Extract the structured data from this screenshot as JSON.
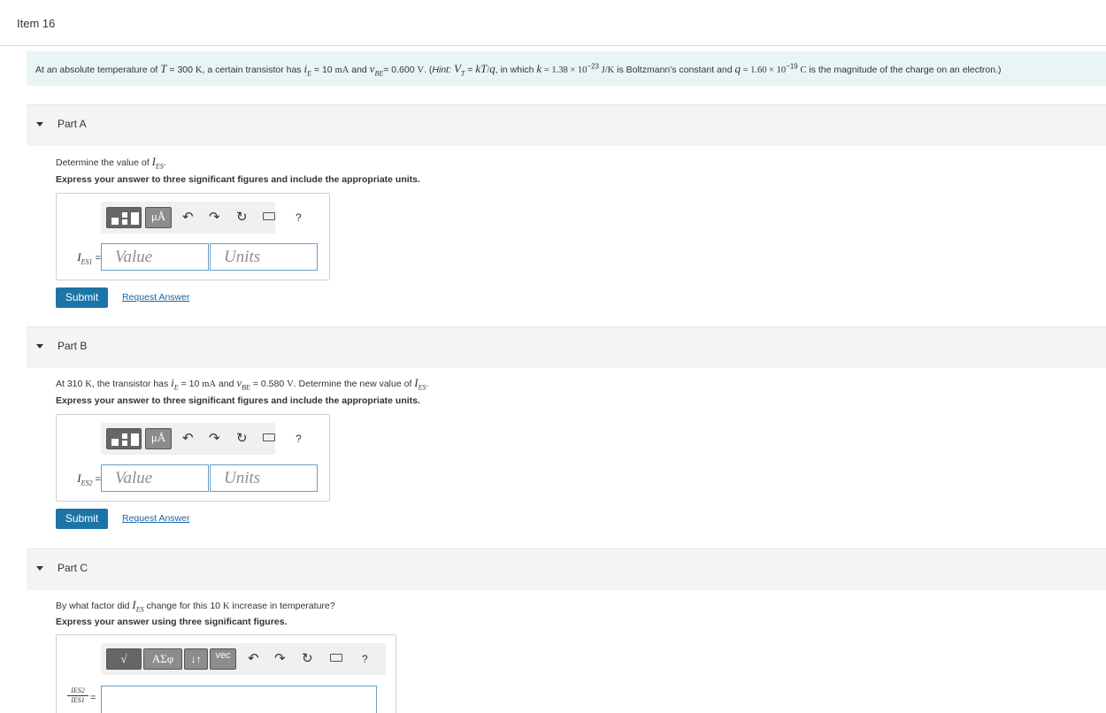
{
  "item_title": "Item 16",
  "problem": {
    "t1": "At an absolute temperature of ",
    "T": "T",
    "t2": " = 300 ",
    "K": "K",
    "t3": ", a certain transistor has ",
    "iE": "i",
    "iE_sub": "E",
    "t4": " = 10 ",
    "mA": "mA",
    "t5": " and ",
    "vBE": "v",
    "vBE_sub": "BE",
    "t6": "= 0.600 ",
    "V": "V",
    "t7": ". (",
    "hint": "Hint:",
    "t8": " ",
    "VT": "V",
    "VT_sub": "T",
    "t9": " = ",
    "kT": "kT",
    "slash": "/",
    "q": "q",
    "t10": ", in which ",
    "k": "k",
    "t11": " = 1.38 × 10",
    "exp1": "−23",
    "t12": " J/K",
    "t13": " is Boltzmann's constant and ",
    "q2": "q",
    "t14": " = 1.60 × 10",
    "exp2": "−19",
    "t15": " C",
    "t16": " is the magnitude of the charge on an electron.)"
  },
  "partA": {
    "label": "Part A",
    "prompt_pre": "Determine the value of ",
    "I": "I",
    "I_sub": "ES",
    "prompt_post": ".",
    "instruction": "Express your answer to three significant figures and include the appropriate units.",
    "mu": "μÅ",
    "help": "?",
    "var": "I",
    "var_sub": "ES1",
    "eq": "=",
    "value_placeholder": "Value",
    "units_placeholder": "Units",
    "submit": "Submit",
    "request": "Request Answer"
  },
  "partB": {
    "label": "Part B",
    "p1": "At 310 ",
    "K": "K",
    "p2": ", the transistor has ",
    "iE": "i",
    "iE_sub": "E",
    "p3": " = 10 ",
    "mA": "mA",
    "p4": " and ",
    "vBE": "v",
    "vBE_sub": "BE",
    "p5": " = 0.580 ",
    "V": "V",
    "p6": ". Determine the new value of ",
    "I": "I",
    "I_sub": "ES",
    "p7": ".",
    "instruction": "Express your answer to three significant figures and include the appropriate units.",
    "mu": "μÅ",
    "help": "?",
    "var": "I",
    "var_sub": "ES2",
    "eq": "=",
    "value_placeholder": "Value",
    "units_placeholder": "Units",
    "submit": "Submit",
    "request": "Request Answer"
  },
  "partC": {
    "label": "Part C",
    "p1": "By what factor did ",
    "I": "I",
    "I_sub": "ES",
    "p2": " change for this 10 ",
    "K": "K",
    "p3": " increase in temperature?",
    "instruction": "Express your answer using three significant figures.",
    "sqrt": "√",
    "greek": "ΑΣφ",
    "arrows": "↓↑",
    "vec": "vec",
    "help": "?",
    "frac_num": "IES2",
    "frac_den": "IES1",
    "eq": "="
  },
  "icons": [
    "undo-icon",
    "redo-icon",
    "reset-icon",
    "keyboard-icon",
    "help-icon",
    "collapse-caret-icon"
  ],
  "colors": {
    "accent": "#1c74a7",
    "problem_bg": "#eaf4f4",
    "header_bg": "#f4f4f4",
    "link": "#1a63a5"
  }
}
